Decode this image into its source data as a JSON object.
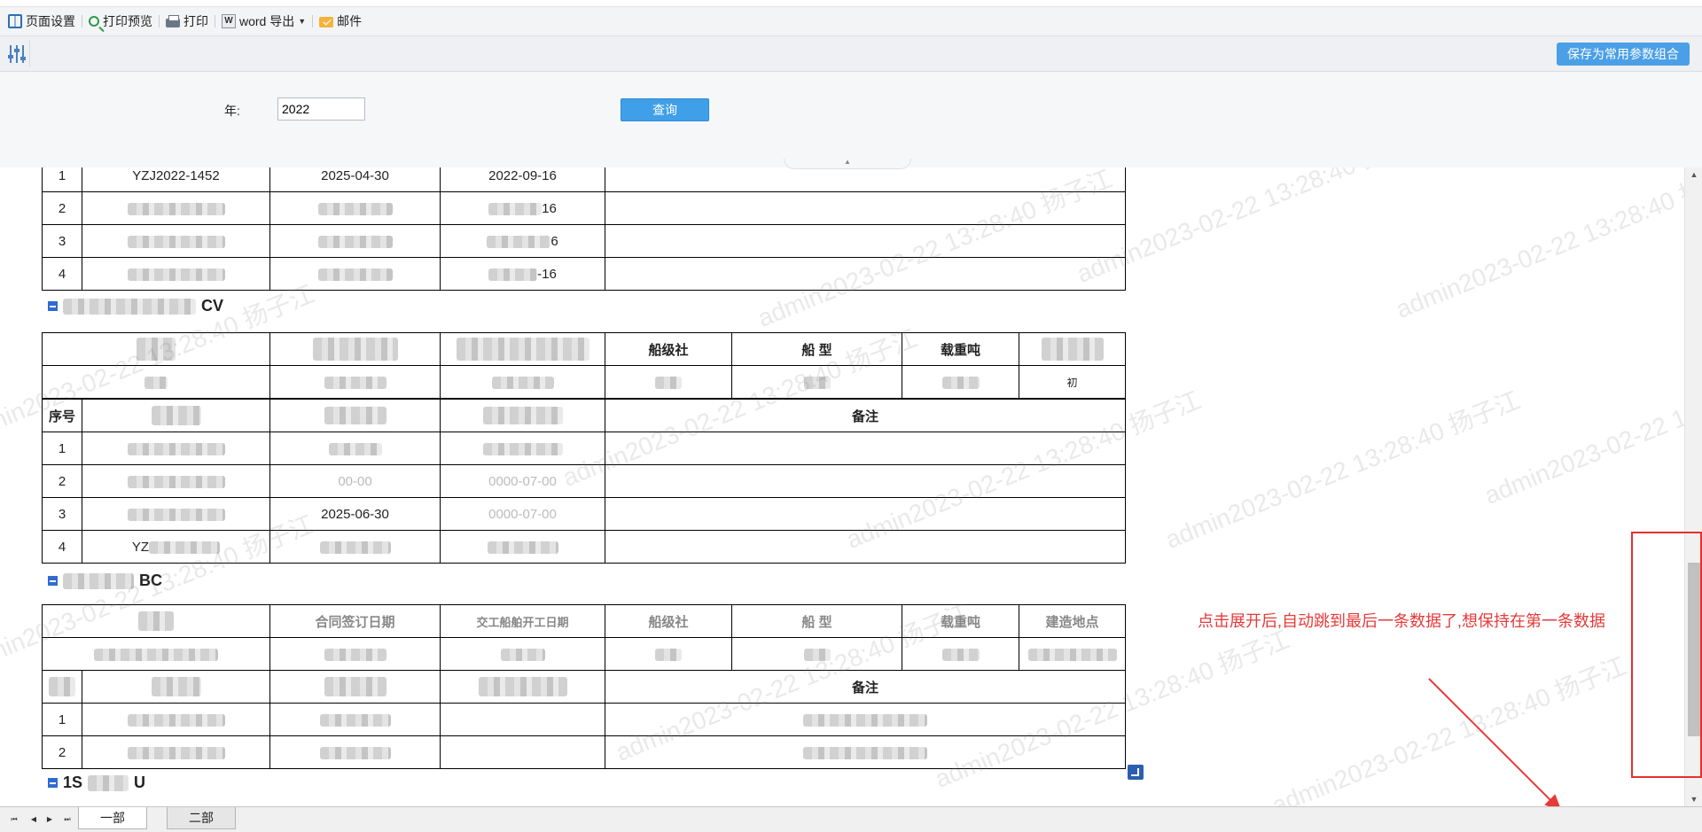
{
  "toolbar": {
    "page_setup": "页面设置",
    "print_preview": "打印预览",
    "print": "打印",
    "word_export": "word 导出",
    "mail": "邮件"
  },
  "params": {
    "save_combo": "保存为常用参数组合",
    "year_label": "年:",
    "year_value": "2022",
    "query_button": "查询"
  },
  "report": {
    "table1": {
      "rows": [
        {
          "index": "1",
          "code": "YZJ2022-1452",
          "date1": "2025-04-30",
          "date2": "2022-09-16"
        },
        {
          "index": "2",
          "date2": "16"
        },
        {
          "index": "3",
          "date2": "6"
        },
        {
          "index": "4",
          "date2": "-16"
        }
      ]
    },
    "section2": {
      "title_suffix": "CV",
      "headers": {
        "col5": "船级社",
        "col6": "船 型",
        "col7": "载重吨",
        "col8_sub": "初"
      },
      "seq_header": "序号",
      "remark_header": "备注",
      "rows": [
        {
          "index": "1"
        },
        {
          "index": "2",
          "date1": "00-00",
          "date2": "0000-07-00"
        },
        {
          "index": "3",
          "date1": "2025-06-30",
          "date2": "0000-07-00"
        },
        {
          "index": "4",
          "code": "YZ"
        }
      ]
    },
    "section3": {
      "title_suffix": "BC",
      "headers": {
        "col2": "合同签订日期",
        "col3": "交工船舶开工日期",
        "col5": "船级社",
        "col6": "船 型",
        "col7": "载重吨",
        "col8": "建造地点"
      },
      "remark_header": "备注",
      "rows": [
        {
          "index": "1"
        },
        {
          "index": "2"
        }
      ]
    },
    "section4": {
      "title_prefix": "1S",
      "title_suffix": "U"
    }
  },
  "watermark_text": "admin2023-02-22 13:28:40 扬子江",
  "annotation": "点击展开后,自动跳到最后一条数据了,想保持在第一条数据",
  "annotation_color": "#e63a3a",
  "sheets": [
    "一部",
    "二部"
  ],
  "accent_color": "#4a9fe6"
}
